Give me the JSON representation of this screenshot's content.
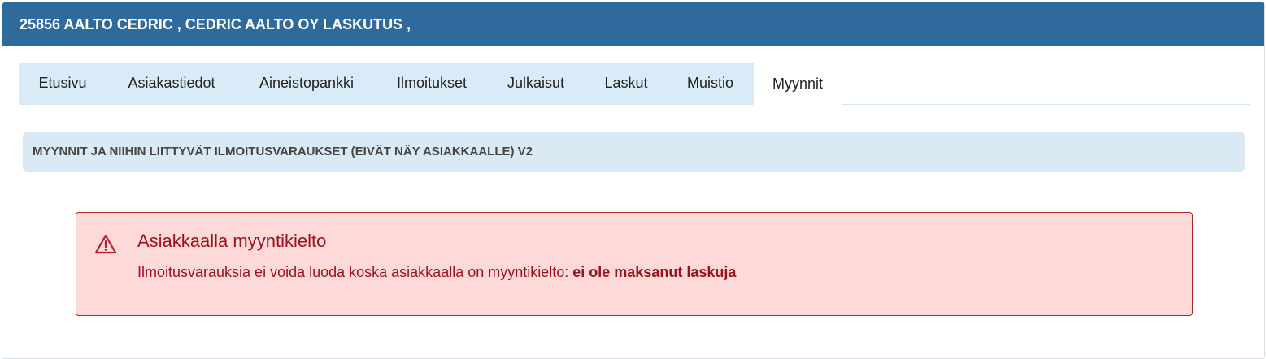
{
  "header": {
    "title": "25856 AALTO CEDRIC , CEDRIC AALTO OY LASKUTUS ,"
  },
  "tabs": [
    {
      "label": "Etusivu",
      "active": false
    },
    {
      "label": "Asiakastiedot",
      "active": false
    },
    {
      "label": "Aineistopankki",
      "active": false
    },
    {
      "label": "Ilmoitukset",
      "active": false
    },
    {
      "label": "Julkaisut",
      "active": false
    },
    {
      "label": "Laskut",
      "active": false
    },
    {
      "label": "Muistio",
      "active": false
    },
    {
      "label": "Myynnit",
      "active": true
    }
  ],
  "section": {
    "title": "MYYNNIT JA NIIHIN LIITTYVÄT ILMOITUSVARAUKSET (EIVÄT NÄY ASIAKKAALLE) V2"
  },
  "alert": {
    "icon": "warning-triangle-icon",
    "title": "Asiakkaalla myyntikielto",
    "message": "Ilmoitusvarauksia ei voida luoda koska asiakkaalla on myyntikielto: ",
    "reason": "ei ole maksanut laskuja"
  },
  "colors": {
    "header_bg": "#2f6a9c",
    "tab_bg": "#d9ebf6",
    "section_bg": "#daeaf5",
    "alert_bg": "#fdd9da",
    "alert_border": "#b3232d",
    "alert_text": "#9b1117"
  }
}
